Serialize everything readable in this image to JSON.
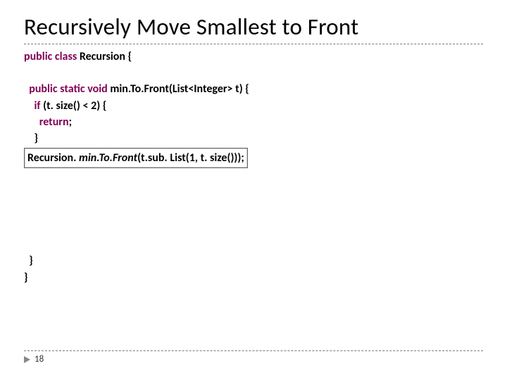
{
  "title": "Recursively Move Smallest to Front",
  "code": {
    "l1a": "public class ",
    "l1b": "Recursion {",
    "l2a": "public static void ",
    "l2b": "min.To.Front(List<Integer> t) {",
    "l3a": "if ",
    "l3b": "(t. size() < 2) {",
    "l4a": "return",
    "l4b": ";",
    "l5": "}",
    "l6a": "Recursion. ",
    "l6b": "min.To.Front",
    "l6c": "(t.sub. List(1, t. size()));",
    "l7": "}",
    "l8": "}"
  },
  "page_number": "18"
}
